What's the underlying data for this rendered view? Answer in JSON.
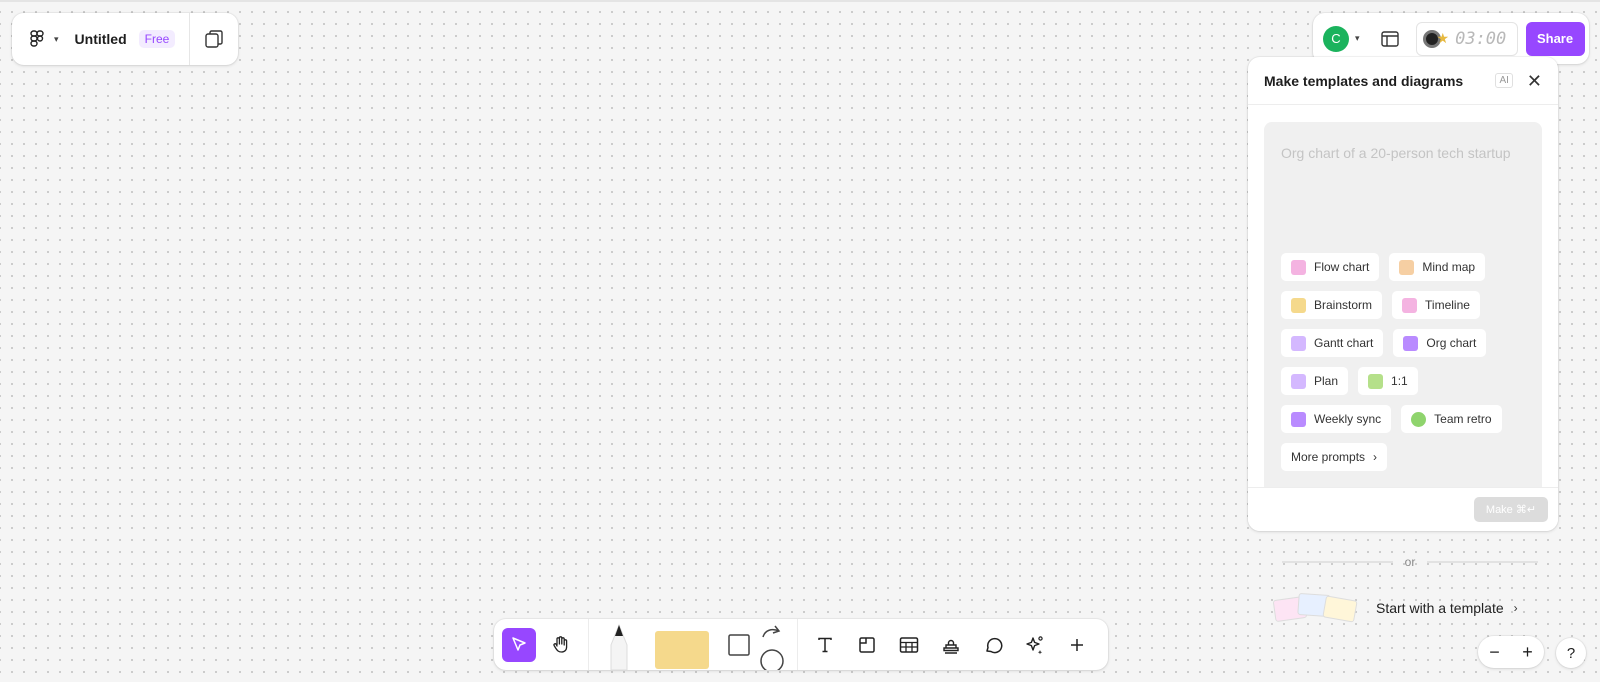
{
  "header": {
    "title": "Untitled",
    "plan_badge": "Free"
  },
  "collab": {
    "avatar_letter": "C",
    "avatar_color": "#1bb35d",
    "timer": "03:00",
    "share_label": "Share",
    "accent": "#9747ff"
  },
  "ai_panel": {
    "title": "Make templates and diagrams",
    "badge": "AI",
    "prompt_placeholder": "Org chart of a 20-person tech startup",
    "chips": [
      {
        "label": "Flow chart",
        "icon": "flow-chart-icon",
        "color": "#f4b3e1"
      },
      {
        "label": "Mind map",
        "icon": "mind-map-icon",
        "color": "#f6cfa3"
      },
      {
        "label": "Brainstorm",
        "icon": "brainstorm-icon",
        "color": "#f5d98c"
      },
      {
        "label": "Timeline",
        "icon": "timeline-icon",
        "color": "#f4b3e1"
      },
      {
        "label": "Gantt chart",
        "icon": "gantt-chart-icon",
        "color": "#d4b8ff"
      },
      {
        "label": "Org chart",
        "icon": "org-chart-icon",
        "color": "#b98bff"
      },
      {
        "label": "Plan",
        "icon": "plan-icon",
        "color": "#d4b8ff"
      },
      {
        "label": "1:1",
        "icon": "one-on-one-icon",
        "color": "#b5e08a"
      },
      {
        "label": "Weekly sync",
        "icon": "weekly-sync-icon",
        "color": "#b98bff"
      },
      {
        "label": "Team retro",
        "icon": "team-retro-icon",
        "color": "#8fd46d"
      }
    ],
    "more_prompts": "More prompts",
    "make_label": "Make ⌘↵"
  },
  "template_section": {
    "or_label": "or",
    "start_label": "Start with a template"
  },
  "zoom": {
    "minus": "−",
    "plus": "+"
  },
  "help": "?"
}
